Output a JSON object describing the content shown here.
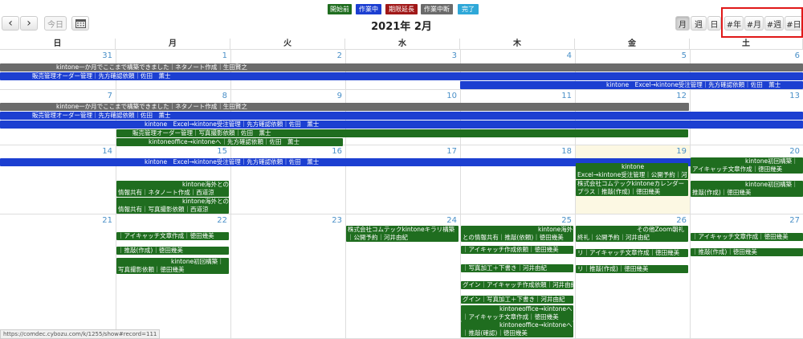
{
  "legend": [
    {
      "label": "開始前",
      "color": "#1f6d1f"
    },
    {
      "label": "作業中",
      "color": "#1c3fd1"
    },
    {
      "label": "期限延長",
      "color": "#a01818"
    },
    {
      "label": "作業中断",
      "color": "#6b6b6b"
    },
    {
      "label": "完了",
      "color": "#2fa8d8"
    }
  ],
  "toolbar": {
    "prev": "‹",
    "next": "›",
    "today": "今日",
    "calendar_icon": "calendar-icon",
    "title": "2021年 2月",
    "views": [
      "月",
      "週",
      "日"
    ],
    "extra_views": [
      "#年",
      "#月",
      "#週",
      "#日"
    ]
  },
  "day_headers": [
    "日",
    "月",
    "火",
    "水",
    "木",
    "金",
    "土"
  ],
  "weeks": [
    [
      "31",
      "1",
      "2",
      "3",
      "4",
      "5",
      "6"
    ],
    [
      "7",
      "8",
      "9",
      "10",
      "11",
      "12",
      "13"
    ],
    [
      "14",
      "15",
      "16",
      "17",
      "18",
      "19",
      "20"
    ],
    [
      "21",
      "22",
      "23",
      "24",
      "25",
      "26",
      "27"
    ]
  ],
  "events": {
    "w1_gray": "kintone一か月でここまで構築できました｜ネタノート作成｜生田賢之",
    "w1_blue1": "販売管理オーダー管理｜先方確認依頼｜佐田　薫士",
    "w1_blue2": "kintone　Excel→kintone受注管理｜先方確認依頼｜佐田　薫士",
    "w2_gray": "kintone一か月でここまで構築できました｜ネタノート作成｜生田賢之",
    "w2_blue1": "販売管理オーダー管理｜先方確認依頼｜佐田　薫士",
    "w2_blue2": "kintone　Excel→kintone受注管理｜先方確認依頼｜佐田　薫士",
    "w2_green1": "販売管理オーダー管理｜写真撮影依頼｜佐田　薫士",
    "w2_green2": "kintoneoffice→kintoneへ｜先方確認依頼｜佐田　薫士",
    "w3_blue": "kintone　Excel→kintone受注管理｜先方確認依頼｜佐田　薫士",
    "w3_mon1": "kintone海外との情報共有｜ネタノート作成｜西道涼",
    "w3_mon2": "kintone海外との情報共有｜写真撮影依頼｜西道涼",
    "w3_fri1": "kintone　Excel→kintone受注管理｜公開予約｜河井由紀",
    "w3_fri2": "株式会社コムテックkintoneカレンダープラス｜推敲(作成)｜徳田幾美",
    "w3_sat1": "kintone初回構築｜アイキャッチ文章作成｜徳田幾美",
    "w3_sat2": "kintone初回構築｜推敲(作成)｜徳田幾美",
    "w4_mon1": "｜アイキャッチ文章作成｜徳田幾美",
    "w4_mon2": "｜推敲(作成)｜徳田幾美",
    "w4_mon3": "kintone初回構築｜写真撮影依頼｜徳田幾美",
    "w4_wed": "株式会社コムテックkintoneキラリ構築｜公開予約｜河井由紀",
    "w4_thu1": "kintone海外との情報共有｜推敲(依頼)｜徳田幾美",
    "w4_thu2": "｜アイキャッチ作成依頼｜徳田幾美",
    "w4_thu3": "｜写真加工＋下書き｜河井由紀",
    "w4_thu4": "グイン｜アイキャッチ作成依頼｜河井由紀",
    "w4_thu5": "グイン｜写真加工＋下書き｜河井由紀",
    "w4_thu6": "kintoneoffice→kintoneへ｜アイキャッチ文章作成｜徳田幾美",
    "w4_thu7": "kintoneoffice→kintoneへ｜推敲(確認)｜徳田幾美",
    "w4_fri1": "その他Zoom朝礼終礼｜公開予約｜河井由紀",
    "w4_fri2": "リ｜アイキャッチ文章作成｜徳田幾美",
    "w4_fri3": "リ｜推敲(作成)｜徳田幾美",
    "w4_sat1": "｜アイキャッチ文章作成｜徳田幾美",
    "w4_sat2": "｜推敲(作成)｜徳田幾美"
  },
  "status_url": "https://comdec.cybozu.com/k/1255/show#record=111"
}
